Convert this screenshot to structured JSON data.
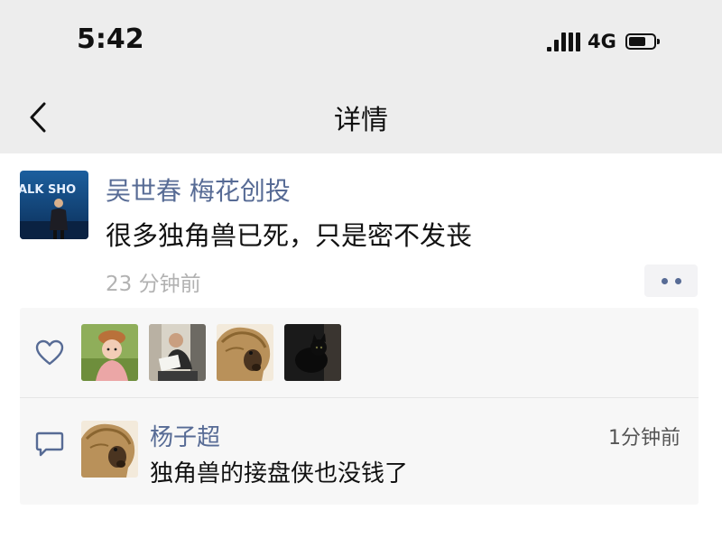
{
  "status_bar": {
    "time": "5:42",
    "network": "4G",
    "battery_level": 0.7
  },
  "nav": {
    "title": "详情"
  },
  "post": {
    "avatar_text": "ALK SHO",
    "author": "吴世春 梅花创投",
    "content": "很多独角兽已死，只是密不发丧",
    "time": "23 分钟前"
  },
  "likes": {
    "avatars": [
      "child-avatar",
      "man-reading-avatar",
      "alpaca-avatar",
      "black-cat-avatar"
    ]
  },
  "comments": [
    {
      "avatar": "alpaca-avatar",
      "name": "杨子超",
      "time": "1分钟前",
      "text": "独角兽的接盘侠也没钱了"
    }
  ],
  "colors": {
    "link": "#576b95",
    "header_bg": "#ededed",
    "panel_bg": "#f7f7f7",
    "secondary_text": "#b2b2b2"
  }
}
